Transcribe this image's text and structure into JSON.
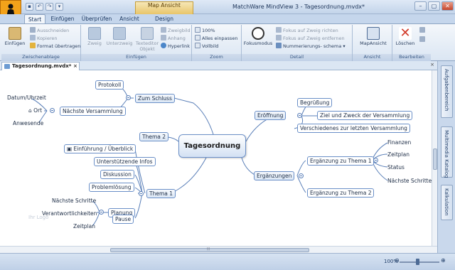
{
  "window": {
    "title": "MatchWare MindView 3 - Tagesordnung.mvdx*",
    "context_tab": "Map Ansicht",
    "controls": [
      "–",
      "▢",
      "✕"
    ]
  },
  "tabs": [
    "Start",
    "Einfügen",
    "Überprüfen",
    "Ansicht",
    "Design"
  ],
  "ribbon": {
    "clipboard": {
      "label": "Zwischenablage",
      "paste": "Einfügen",
      "cut": "Ausschneiden",
      "copy": "Kopieren",
      "format": "Format übertragen"
    },
    "insert": {
      "label": "Einfügen",
      "branch": "Zweig",
      "subbranch": "Unterzweig",
      "text_object": "Texteditor Objekt",
      "branch_image": "Zweigbild",
      "attachment": "Anhang",
      "hyperlink": "Hyperlink"
    },
    "zoom": {
      "label": "Zoom",
      "zoom100": "100%",
      "fit_all": "Alles einpassen",
      "fullscreen": "Vollbild"
    },
    "detail": {
      "label": "Detail",
      "focus": "Fokusmodus",
      "focus_branch": "Fokus auf Zweig richten",
      "focus_remove": "Fokus auf Zweig entfernen",
      "numbering": "Nummerierungs- schema"
    },
    "view": {
      "label": "Ansicht",
      "map_view": "MapAnsicht"
    },
    "edit": {
      "label": "Bearbeiten",
      "delete": "Löschen"
    }
  },
  "document": {
    "tab_name": "Tagesordnung.mvdx*",
    "close": "×"
  },
  "side_panels": [
    "Aufgabenbereich",
    "Multimedia Katalog",
    "Kalkulation"
  ],
  "status": {
    "zoom": "100%"
  },
  "map": {
    "central": "Tagesordnung",
    "zum_schluss": {
      "label": "Zum Schluss",
      "protokoll": "Protokoll",
      "naechste": "Nächste Versammlung",
      "datum": "Datum/Uhrzeit",
      "ort": "Ort",
      "anwesende": "Anwesende"
    },
    "thema2": "Thema 2",
    "thema1": {
      "label": "Thema 1",
      "items": [
        "Einführung / Überblick",
        "Unterstützende Infos",
        "Diskussion",
        "Problemlösung"
      ],
      "planung": "Planung",
      "planung_items": [
        "Nächste Schritte",
        "Verantwortlichkeiten",
        "Zeitplan"
      ],
      "pause": "Pause"
    },
    "eroeffnung": {
      "label": "Eröffnung",
      "items": [
        "Begrüßung",
        "Ziel und Zweck der Versammlung",
        "Verschiedenes zur letzten Versammlung"
      ]
    },
    "ergaenzungen": {
      "label": "Ergänzungen",
      "thema1": "Ergänzung zu Thema 1",
      "thema1_items": [
        "Finanzen",
        "Zeitplan",
        "Status",
        "Nächste Schritte"
      ],
      "thema2": "Ergänzung zu Thema 2"
    },
    "faded_text": "Ihr Logo"
  }
}
